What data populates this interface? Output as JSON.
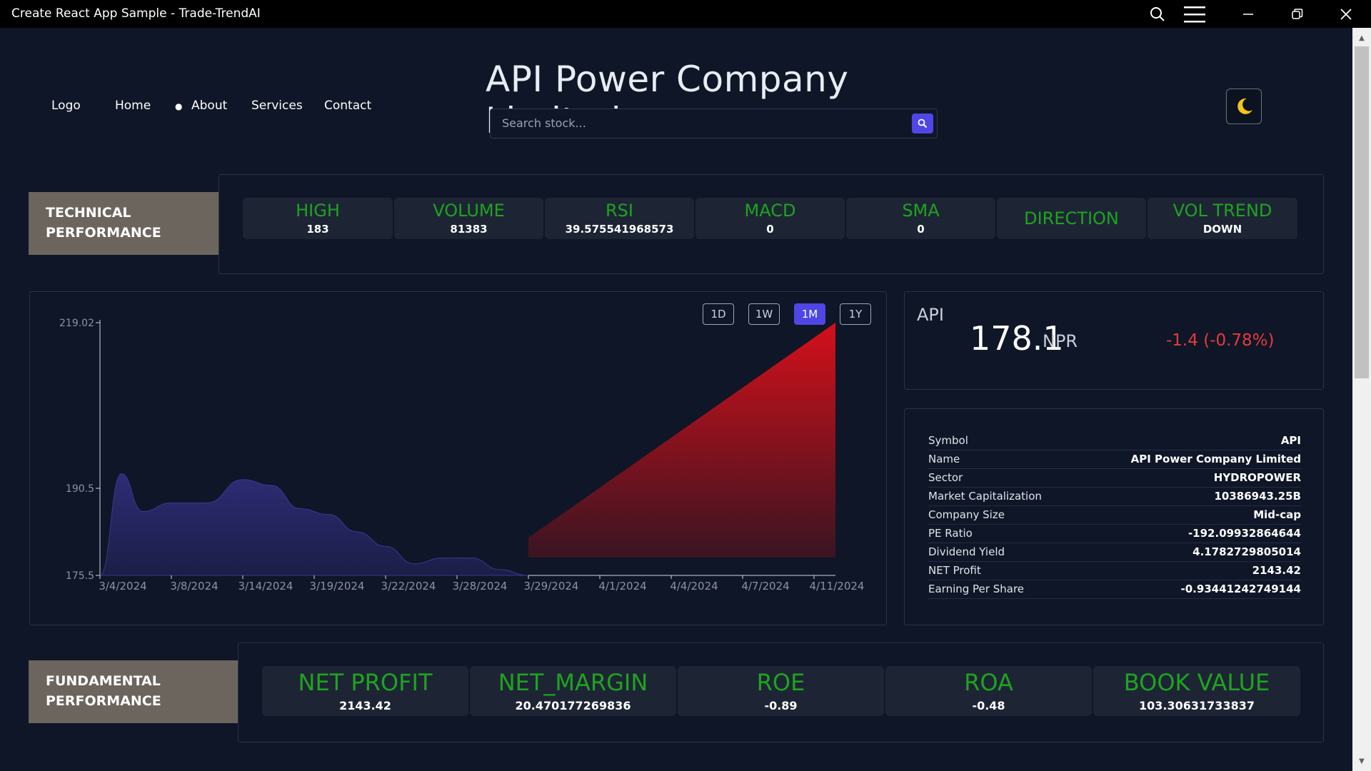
{
  "window": {
    "title": "Create React App Sample - Trade-TrendAI"
  },
  "nav": {
    "logo": "Logo",
    "home": "Home",
    "about": "About",
    "services": "Services",
    "contact": "Contact"
  },
  "header": {
    "company_name": "API Power Company Limited",
    "search_placeholder": "Search stock..."
  },
  "technical": {
    "label_line1": "TECHNICAL",
    "label_line2": "PERFORMANCE",
    "metrics": [
      {
        "label": "HIGH",
        "value": "183"
      },
      {
        "label": "VOLUME",
        "value": "81383"
      },
      {
        "label": "RSI",
        "value": "39.575541968573"
      },
      {
        "label": "MACD",
        "value": "0"
      },
      {
        "label": "SMA",
        "value": "0"
      },
      {
        "label": "DIRECTION",
        "value": ""
      },
      {
        "label": "VOL TREND",
        "value": "DOWN"
      }
    ]
  },
  "chart_controls": {
    "ranges": [
      "1D",
      "1W",
      "1M",
      "1Y"
    ],
    "active": "1M"
  },
  "chart_data": {
    "type": "area",
    "x_ticks": [
      "3/4/2024",
      "3/8/2024",
      "3/14/2024",
      "3/19/2024",
      "3/22/2024",
      "3/28/2024",
      "3/29/2024",
      "4/1/2024",
      "4/4/2024",
      "4/7/2024",
      "4/11/2024"
    ],
    "y_ticks": [
      219.02,
      190.5,
      175.5
    ],
    "ylim": [
      175.5,
      219.02
    ],
    "series": [
      {
        "color": "#2b2a6e",
        "x": [
          0.0,
          0.3,
          0.6,
          1.0,
          1.5,
          2.0,
          2.4,
          2.8,
          3.2,
          3.6,
          4.0,
          4.4,
          4.8,
          5.2,
          5.6,
          6.0
        ],
        "values": [
          175.5,
          193,
          186.5,
          188,
          188,
          192,
          191,
          187,
          186,
          183,
          180.5,
          177.5,
          178.5,
          178.5,
          176.5,
          175.5
        ]
      },
      {
        "color": "#c4121b",
        "x": [
          6.0,
          10.3
        ],
        "values": [
          182,
          219.02
        ]
      }
    ],
    "colors": {
      "historical": "#2b2a6e",
      "projection": "#c4121b"
    }
  },
  "quote": {
    "symbol": "API",
    "price": "178.1",
    "currency": "NPR",
    "change": "-1.4 (-0.78%)"
  },
  "info_rows": [
    {
      "k": "Symbol",
      "v": "API"
    },
    {
      "k": "Name",
      "v": "API Power Company Limited"
    },
    {
      "k": "Sector",
      "v": "HYDROPOWER"
    },
    {
      "k": "Market Capitalization",
      "v": "10386943.25B"
    },
    {
      "k": "Company Size",
      "v": "Mid-cap"
    },
    {
      "k": "PE Ratio",
      "v": "-192.09932864644"
    },
    {
      "k": "Dividend Yield",
      "v": "4.1782729805014"
    },
    {
      "k": "NET Profit",
      "v": "2143.42"
    },
    {
      "k": "Earning Per Share",
      "v": "-0.93441242749144"
    }
  ],
  "fundamental": {
    "label_line1": "FUNDAMENTAL",
    "label_line2": "PERFORMANCE",
    "metrics": [
      {
        "label": "NET PROFIT",
        "value": "2143.42"
      },
      {
        "label": "NET_MARGIN",
        "value": "20.470177269836"
      },
      {
        "label": "ROE",
        "value": "-0.89"
      },
      {
        "label": "ROA",
        "value": "-0.48"
      },
      {
        "label": "BOOK VALUE",
        "value": "103.30631733837"
      }
    ]
  },
  "colors": {
    "accent": "#4f46e5",
    "metric_label": "#1fa31f",
    "negative": "#e53b3b",
    "section_label_bg": "#6b655e"
  }
}
